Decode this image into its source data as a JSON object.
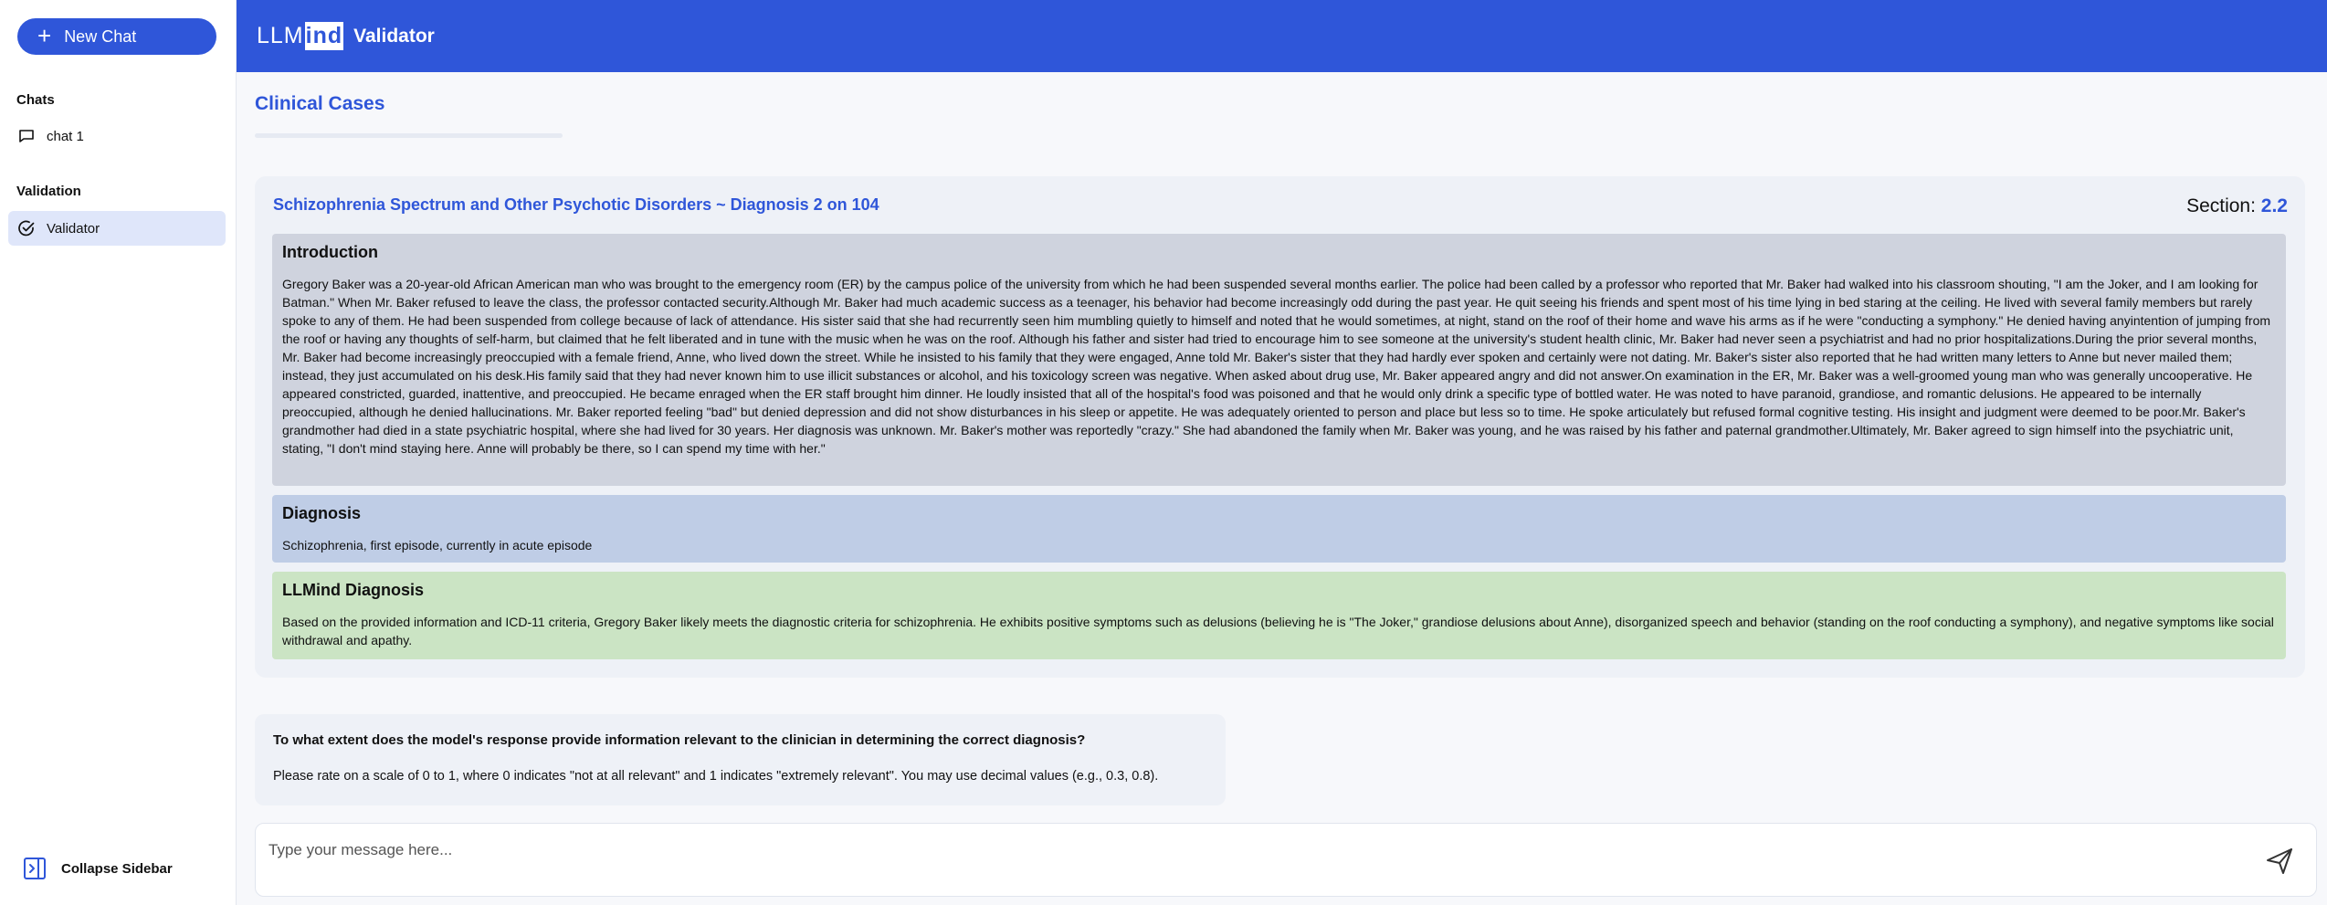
{
  "sidebar": {
    "new_chat_label": "New Chat",
    "chats_heading": "Chats",
    "chats": [
      {
        "label": "chat 1",
        "icon": "chat-bubble-icon"
      }
    ],
    "validation_heading": "Validation",
    "validation_items": [
      {
        "label": "Validator",
        "icon": "check-circle-icon",
        "active": true
      }
    ],
    "collapse_label": "Collapse Sidebar"
  },
  "header": {
    "logo_prefix": "LLM",
    "logo_boxed": "ind",
    "title": "Validator",
    "color": "#2f56d9"
  },
  "main": {
    "page_title": "Clinical Cases",
    "case": {
      "title": "Schizophrenia Spectrum and Other Psychotic Disorders ~ Diagnosis 2 on 104",
      "section_label": "Section:",
      "section_value": "2.2",
      "introduction": {
        "heading": "Introduction",
        "text": "Gregory Baker was a 20-year-old African American man who was brought to the emergency room (ER) by the campus police of the university from which he had been suspended several months earlier. The police had been called by a professor who reported that Mr. Baker had walked into his classroom shouting, \"I am the Joker, and I am looking for Batman.\" When Mr. Baker refused to leave the class, the professor contacted security.Although Mr. Baker had much academic success as a teenager, his behavior had become increasingly odd during the past year. He quit seeing his friends and spent most of his time lying in bed staring at the ceiling. He lived with several family members but rarely spoke to any of them. He had been suspended from college because of lack of attendance. His sister said that she had recurrently seen him mumbling quietly to himself and noted that he would sometimes, at night, stand on the roof of their home and wave his arms as if he were \"conducting a symphony.\" He denied having anyintention of jumping from the roof or having any thoughts of self-harm, but claimed that he felt liberated and in tune with the music when he was on the roof. Although his father and sister had tried to encourage him to see someone at the university's student health clinic, Mr. Baker had never seen a psychiatrist and had no prior hospitalizations.During the prior several months, Mr. Baker had become increasingly preoccupied with a female friend, Anne, who lived down the street. While he insisted to his family that they were engaged, Anne told Mr. Baker's sister that they had hardly ever spoken and certainly were not dating. Mr. Baker's sister also reported that he had written many letters to Anne but never mailed them; instead, they just accumulated on his desk.His family said that they had never known him to use illicit substances or alcohol, and his toxicology screen was negative. When asked about drug use, Mr. Baker appeared angry and did not answer.On examination in the ER, Mr. Baker was a well-groomed young man who was generally uncooperative. He appeared constricted, guarded, inattentive, and preoccupied. He became enraged when the ER staff brought him dinner. He loudly insisted that all of the hospital's food was poisoned and that he would only drink a specific type of bottled water. He was noted to have paranoid, grandiose, and romantic delusions. He appeared to be internally preoccupied, although he denied hallucinations. Mr. Baker reported feeling \"bad\" but denied depression and did not show disturbances in his sleep or appetite. He was adequately oriented to person and place but less so to time. He spoke articulately but refused formal cognitive testing. His insight and judgment were deemed to be poor.Mr. Baker's grandmother had died in a state psychiatric hospital, where she had lived for 30 years. Her diagnosis was unknown. Mr. Baker's mother was reportedly \"crazy.\" She had abandoned the family when Mr. Baker was young, and he was raised by his father and paternal grandmother.Ultimately, Mr. Baker agreed to sign himself into the psychiatric unit, stating, \"I don't mind staying here. Anne will probably be there, so I can spend my time with her.\""
      },
      "diagnosis": {
        "heading": "Diagnosis",
        "text": "Schizophrenia, first episode, currently in acute episode"
      },
      "llm_diagnosis": {
        "heading": "LLMind Diagnosis",
        "text": "Based on the provided information and ICD-11 criteria, Gregory Baker likely meets the diagnostic criteria for schizophrenia. He exhibits positive symptoms such as delusions (believing he is \"The Joker,\" grandiose delusions about Anne), disorganized speech and behavior (standing on the roof conducting a symphony), and negative symptoms like social withdrawal and apathy."
      }
    },
    "question": {
      "text": "To what extent does the model's response provide information relevant to the clinician in determining the correct diagnosis?",
      "instruction": "Please rate on a scale of 0 to 1, where 0 indicates \"not at all relevant\" and 1 indicates \"extremely relevant\". You may use decimal values (e.g., 0.3, 0.8)."
    },
    "input": {
      "placeholder": "Type your message here..."
    }
  },
  "colors": {
    "accent": "#2f56d9",
    "intro_bg": "#cfd3de",
    "diagnosis_bg": "#bfcde6",
    "llm_bg": "#cbe4c4"
  }
}
